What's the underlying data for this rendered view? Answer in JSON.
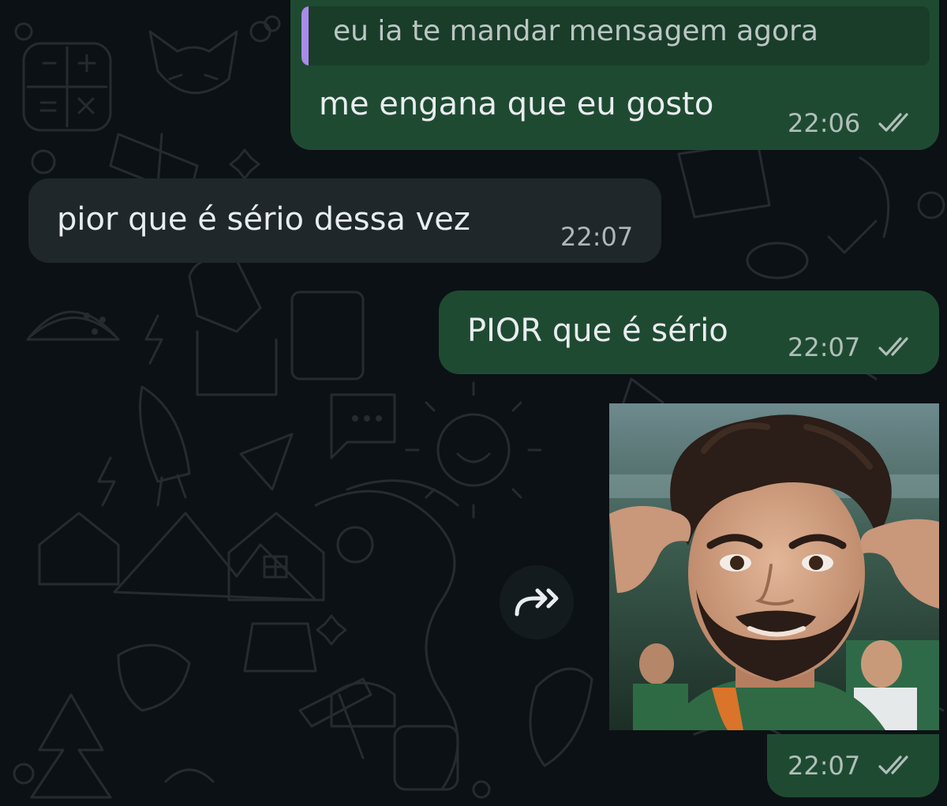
{
  "messages": [
    {
      "direction": "outgoing",
      "quoted_text": "eu ia te mandar mensagem agora",
      "text": "me engana que eu gosto",
      "time": "22:06",
      "status_icon": "double-check-icon"
    },
    {
      "direction": "incoming",
      "text": "pior que é sério dessa vez",
      "time": "22:07"
    },
    {
      "direction": "outgoing",
      "text": "PIOR que é sério",
      "time": "22:07",
      "status_icon": "double-check-icon"
    },
    {
      "direction": "outgoing",
      "type": "image",
      "image_description": "selfie of a smiling bearded man with messy dark hair, fingers at his temples",
      "time": "22:07",
      "status_icon": "double-check-icon",
      "action_icon": "forward-icon"
    }
  ],
  "colors": {
    "background": "#0c1115",
    "outgoing_bubble": "#1f4a32",
    "incoming_bubble": "#1f272b",
    "quote_bar": "#a98be8",
    "text": "#e9edef"
  }
}
